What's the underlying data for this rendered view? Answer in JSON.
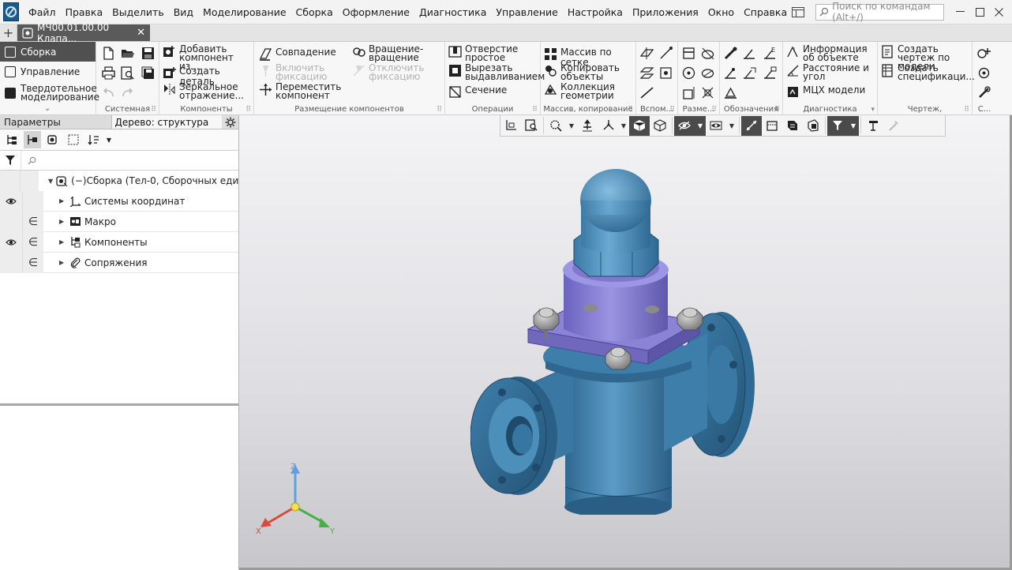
{
  "menubar": {
    "items": [
      "Файл",
      "Правка",
      "Выделить",
      "Вид",
      "Моделирование",
      "Сборка",
      "Оформление",
      "Диагностика",
      "Управление",
      "Настройка",
      "Приложения",
      "Окно",
      "Справка"
    ],
    "search_placeholder": "Поиск по командам (Alt+/)"
  },
  "tabbar": {
    "doc_tab_label": "МЧ00.01.00.00 Клапа..."
  },
  "ribbon": {
    "modes": [
      "Сборка",
      "Управление",
      "Твердотельное моделирование"
    ],
    "groups": {
      "system": "Системная",
      "components": "Компоненты",
      "placement": "Размещение компонентов",
      "operations": "Операции",
      "array": "Массив, копирование",
      "auxiliary": "Вспом...",
      "dimensions": "Разме...",
      "designations": "Обозначения",
      "diagnostics": "Диагностика",
      "drawing": "Чертеж, спецификац...",
      "last": "С..."
    },
    "buttons": {
      "add_component": "Добавить компонент из...",
      "create_part": "Создать деталь",
      "mirror": "Зеркальное отражение...",
      "coincidence": "Совпадение",
      "enable_fix": "Включить фиксацию",
      "move_component": "Переместить компонент",
      "rotation": "Вращение-вращение",
      "disable_fix": "Отключить фиксацию",
      "hole_simple": "Отверстие простое",
      "cut_extrude": "Вырезать выдавливанием",
      "section": "Сечение",
      "grid_array": "Массив по сетке",
      "copy_objects": "Копировать объекты",
      "geometry_collection": "Коллекция геометрии",
      "object_info": "Информация об объекте",
      "distance_angle": "Расстояние и угол",
      "mass_props": "МЦХ модели",
      "create_drawing": "Создать чертеж по модели",
      "create_spec": "Создать спецификаци..."
    }
  },
  "left_panel": {
    "tab_params": "Параметры",
    "tab_tree": "Дерево: структура",
    "tree": {
      "root": "(−)Сборка (Тел-0, Сборочных едини...",
      "items": [
        "Системы координат",
        "Макро",
        "Компоненты",
        "Сопряжения"
      ]
    },
    "in_symbol": "∈"
  },
  "triad": {
    "x": "X",
    "y": "Y",
    "z": "Z"
  },
  "colors": {
    "body": "#4b8bb5",
    "bonnet": "#8a83d6",
    "accent_dark": "#4a4a4a"
  }
}
